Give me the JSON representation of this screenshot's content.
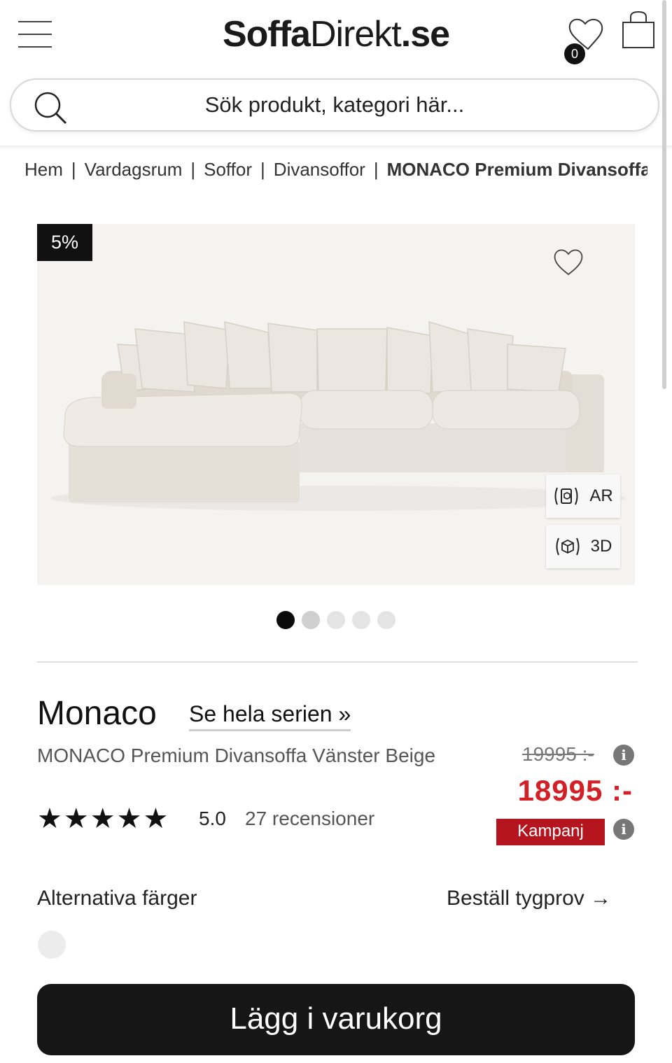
{
  "header": {
    "logo_bold": "Soffa",
    "logo_thin": "Direkt",
    "logo_suffix": ".se",
    "wishlist_count": "0"
  },
  "search": {
    "placeholder": "Sök produkt, kategori här..."
  },
  "breadcrumb": {
    "items": [
      "Hem",
      "Vardagsrum",
      "Soffor",
      "Divansoffor"
    ],
    "current": "MONACO Premium Divansoffa Vänster Beige"
  },
  "gallery": {
    "discount_badge": "5%",
    "ar_label": "AR",
    "threed_label": "3D",
    "slide_count": 5,
    "active_slide": 1
  },
  "product": {
    "series_name": "Monaco",
    "series_link": "Se hela serien »",
    "name": "MONACO Premium Divansoffa Vänster Beige",
    "stars": "★★★★★",
    "rating": "5.0",
    "reviews": "27 recensioner",
    "old_price": "19995 :-",
    "price": "18995 :-",
    "campaign_label": "Kampanj"
  },
  "options": {
    "alt_colors_label": "Alternativa färger",
    "fabric_sample_label": "Beställ tygprov →"
  },
  "actions": {
    "add_to_cart": "Lägg i varukorg"
  },
  "colors": {
    "price_red": "#d32027",
    "campaign_red": "#b4151f",
    "button_dark": "#161616"
  }
}
